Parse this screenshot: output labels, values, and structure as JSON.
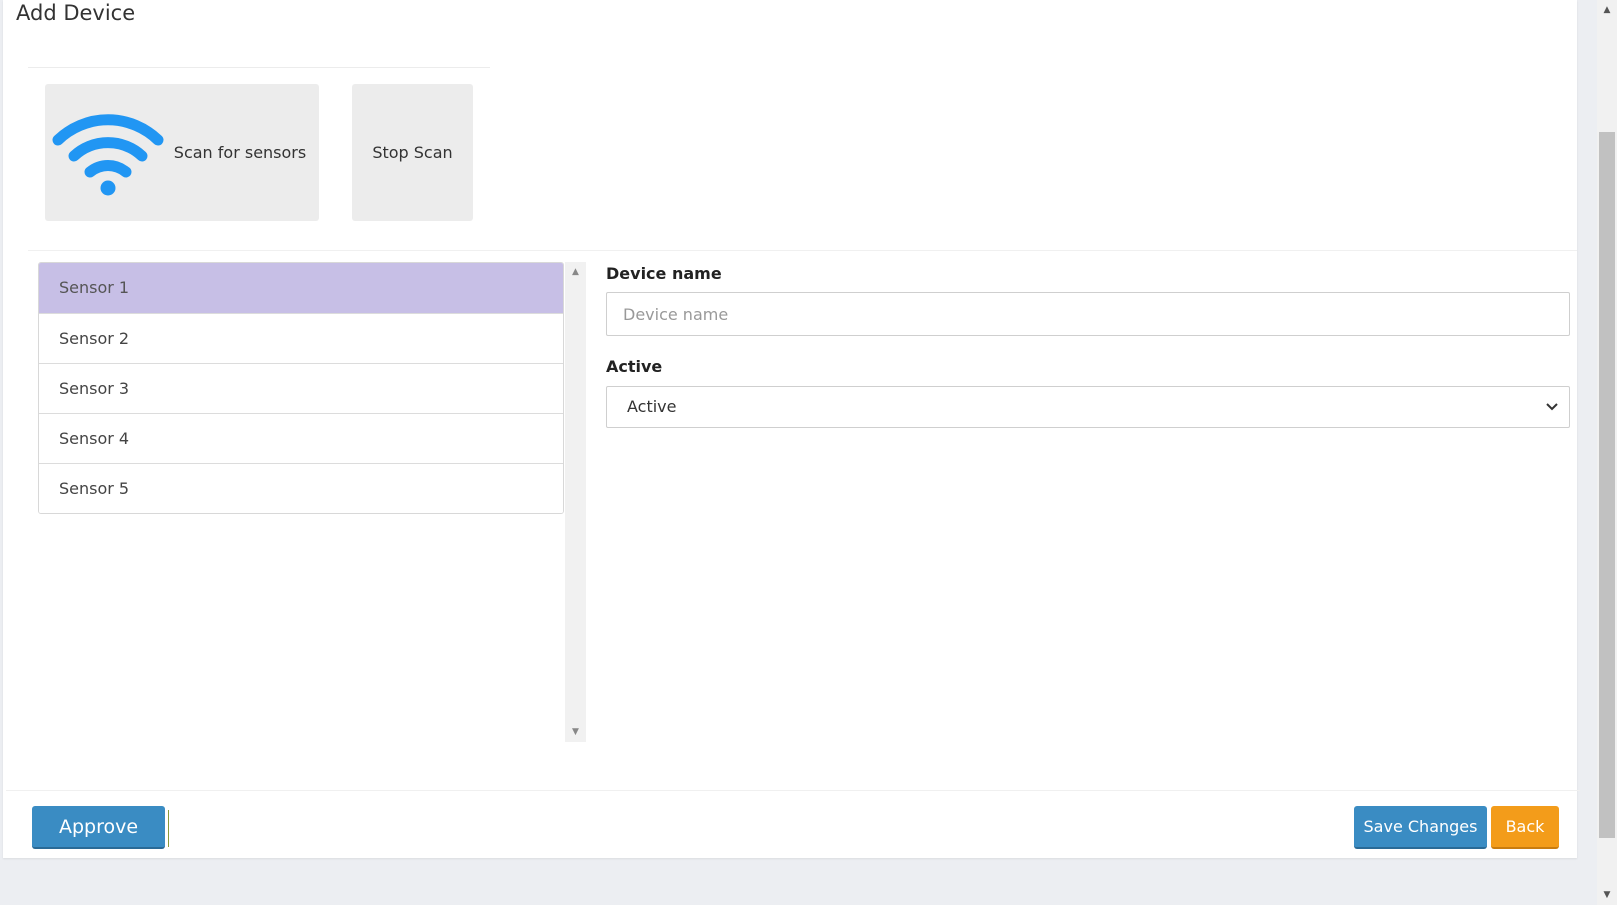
{
  "page": {
    "title": "Add Device"
  },
  "scan": {
    "scan_label": "Scan for sensors",
    "stop_label": "Stop Scan",
    "icon": "wifi-icon",
    "icon_color": "#2196f3"
  },
  "sensors": {
    "items": [
      {
        "label": "Sensor 1",
        "selected": true
      },
      {
        "label": "Sensor 2",
        "selected": false
      },
      {
        "label": "Sensor 3",
        "selected": false
      },
      {
        "label": "Sensor 4",
        "selected": false
      },
      {
        "label": "Sensor 5",
        "selected": false
      }
    ],
    "selected_color": "#c7bfe6"
  },
  "form": {
    "device_name_label": "Device name",
    "device_name_placeholder": "Device name",
    "device_name_value": "",
    "active_label": "Active",
    "active_value": "Active"
  },
  "footer": {
    "approve_label": "Approve",
    "save_label": "Save Changes",
    "back_label": "Back",
    "primary_color": "#3a8cc3",
    "warning_color": "#f39c1a"
  }
}
